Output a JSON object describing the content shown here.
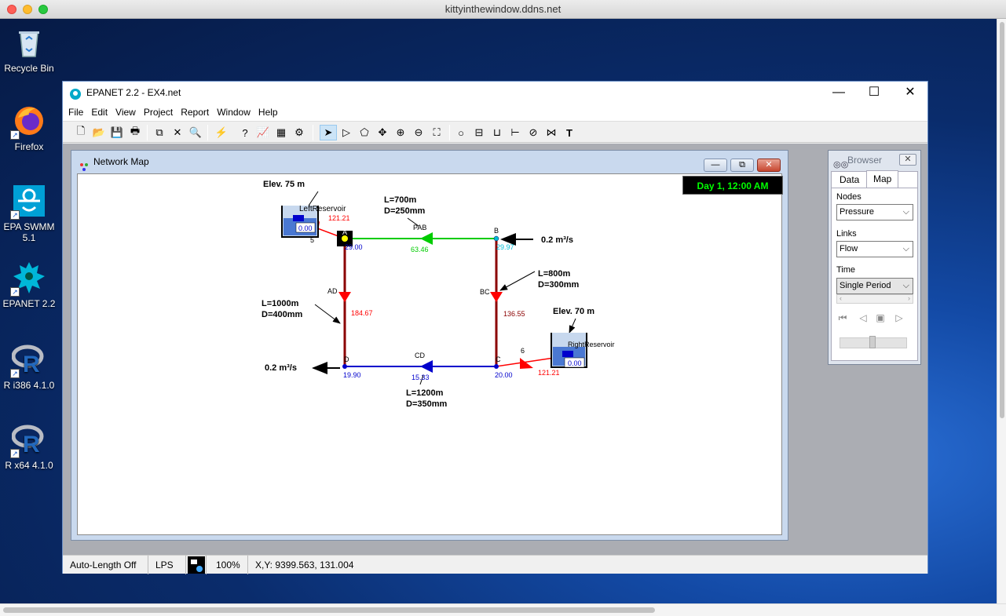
{
  "host": {
    "title": "kittyinthewindow.ddns.net"
  },
  "desktop": {
    "icons": [
      {
        "label": "Recycle Bin"
      },
      {
        "label": "Firefox"
      },
      {
        "label": "EPA SWMM 5.1"
      },
      {
        "label": "EPANET 2.2"
      },
      {
        "label": "R i386 4.1.0"
      },
      {
        "label": "R x64 4.1.0"
      }
    ]
  },
  "app": {
    "title": "EPANET 2.2 - EX4.net",
    "menu": [
      "File",
      "Edit",
      "View",
      "Project",
      "Report",
      "Window",
      "Help"
    ],
    "toolbar_icons": [
      "new-icon",
      "open-icon",
      "save-icon",
      "print-icon",
      "copy-icon",
      "delete-icon",
      "find-icon",
      "run-icon",
      "query-icon",
      "graph-icon",
      "table-icon",
      "options-icon",
      "select-object-icon",
      "select-vertex-icon",
      "select-region-icon",
      "pan-icon",
      "zoom-in-icon",
      "zoom-out-icon",
      "full-extent-icon",
      "add-junction-icon",
      "add-reservoir-icon",
      "add-tank-icon",
      "add-pipe-icon",
      "add-pump-icon",
      "add-valve-icon",
      "add-label-icon"
    ]
  },
  "network_map": {
    "title": "Network Map",
    "clock": "Day 1, 12:00 AM",
    "annotations": {
      "elev_left": "Elev. 75 m",
      "elev_right": "Elev. 70 m",
      "pab_len": "L=700m",
      "pab_dia": "D=250mm",
      "bc_len": "L=800m",
      "bc_dia": "D=300mm",
      "ad_len": "L=1000m",
      "ad_dia": "D=400mm",
      "cd_len": "L=1200m",
      "cd_dia": "D=350mm",
      "inflow_b": "0.2 m³/s",
      "outflow_d": "0.2 m³/s"
    },
    "nodes": {
      "left_reservoir": {
        "id": "LeftReservoir",
        "pressure": "0.00",
        "tag": "5"
      },
      "right_reservoir": {
        "id": "RightReservoir",
        "pressure": "0.00"
      },
      "A": {
        "id": "A",
        "pressure": "29.00"
      },
      "B": {
        "id": "B",
        "pressure": "29.97"
      },
      "C": {
        "id": "C",
        "pressure": "20.00"
      },
      "D": {
        "id": "D",
        "pressure": "19.90"
      }
    },
    "links": {
      "left_pipe": {
        "flow": "121.21"
      },
      "PAB": {
        "id": "PAB",
        "flow": "63.46"
      },
      "AD": {
        "id": "AD",
        "flow": "184.67"
      },
      "BC": {
        "id": "BC",
        "flow": "136.55"
      },
      "CD": {
        "id": "CD",
        "flow": "15.33"
      },
      "right_pipe": {
        "id": "6",
        "flow": "121.21"
      }
    },
    "colors": {
      "red": "#ff0000",
      "dark_red": "#8b0000",
      "green": "#00cc00",
      "blue": "#0000cc",
      "cyan": "#00bcd4"
    }
  },
  "browser": {
    "title": "Browser",
    "tabs": [
      "Data",
      "Map"
    ],
    "active_tab": "Map",
    "nodes_label": "Nodes",
    "nodes_value": "Pressure",
    "links_label": "Links",
    "links_value": "Flow",
    "time_label": "Time",
    "time_value": "Single Period"
  },
  "status": {
    "auto_length": "Auto-Length Off",
    "units": "LPS",
    "zoom": "100%",
    "xy": "X,Y: 9399.563, 131.004"
  }
}
